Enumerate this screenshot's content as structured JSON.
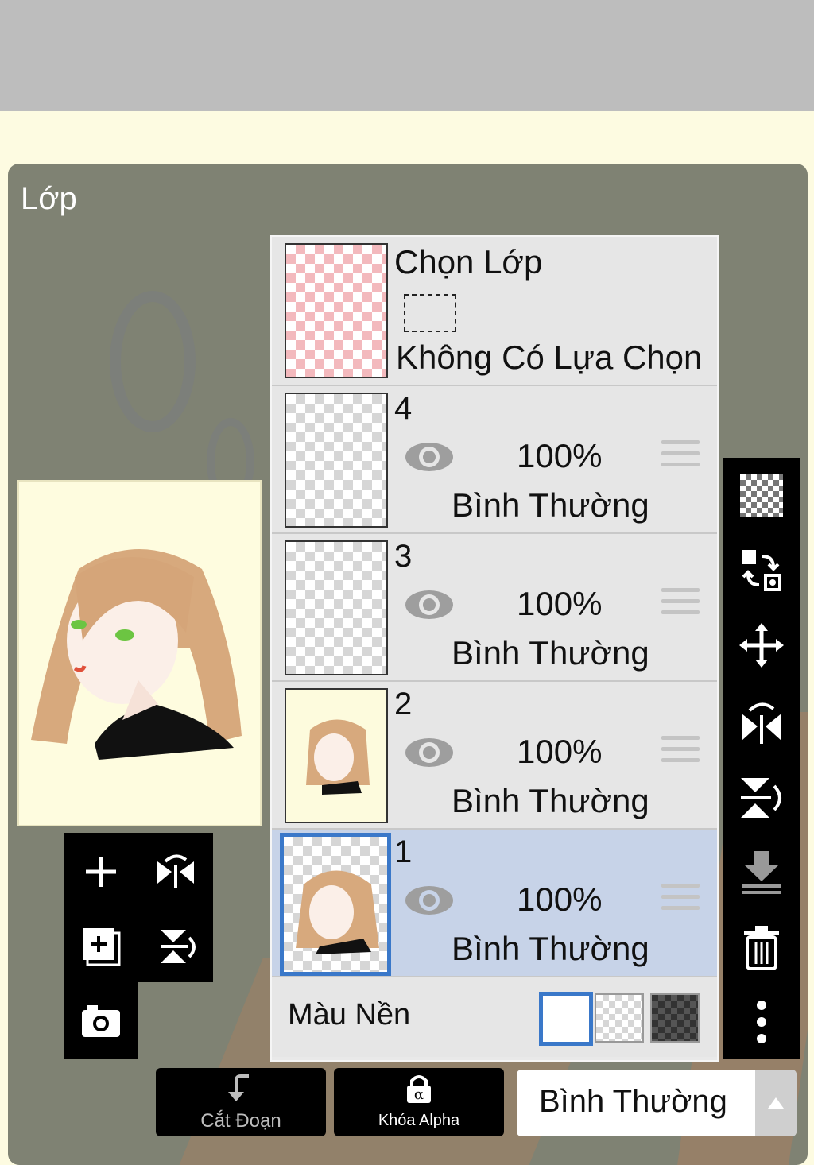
{
  "panel": {
    "title": "Lớp"
  },
  "selection": {
    "title": "Chọn Lớp",
    "status": "Không Có Lựa Chọn"
  },
  "layers": [
    {
      "num": "4",
      "opacity": "100%",
      "blend": "Bình Thường"
    },
    {
      "num": "3",
      "opacity": "100%",
      "blend": "Bình Thường"
    },
    {
      "num": "2",
      "opacity": "100%",
      "blend": "Bình Thường"
    },
    {
      "num": "1",
      "opacity": "100%",
      "blend": "Bình Thường"
    }
  ],
  "background": {
    "label": "Màu Nền"
  },
  "bottom": {
    "clip_label": "Cắt Đoạn",
    "alpha_label": "Khóa Alpha",
    "blend_mode": "Bình Thường"
  },
  "colors": {
    "selected_row": "#c7d3e8",
    "accent": "#3a78c9",
    "panel": "#7f8273",
    "toolbar": "#000000"
  },
  "icons": [
    "add-layer-icon",
    "flip-horizontal-icon",
    "add-layer-copy-icon",
    "flip-vertical-icon",
    "camera-icon",
    "transparency-icon",
    "swap-icon",
    "move-icon",
    "rotate-flip-horizontal-icon",
    "rotate-flip-vertical-icon",
    "merge-down-icon",
    "trash-icon",
    "more-icon",
    "eye-icon",
    "lock-icon",
    "clip-arrow-icon",
    "dropdown-arrow-icon"
  ]
}
